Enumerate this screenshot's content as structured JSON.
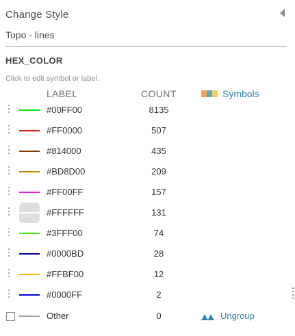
{
  "panel": {
    "title": "Change Style",
    "layer_name": "Topo - lines",
    "field_name": "HEX_COLOR",
    "hint": "Click to edit symbol or label."
  },
  "table": {
    "col_label": "LABEL",
    "col_count": "COUNT",
    "symbols_label": "Symbols",
    "symbols_swatch_colors": [
      "#f2a35c",
      "#58a8c6",
      "#f2d05c"
    ],
    "rows": [
      {
        "label": "#00FF00",
        "count": "8135",
        "color": "#00ee00"
      },
      {
        "label": "#FF0000",
        "count": "507",
        "color": "#cc1111"
      },
      {
        "label": "#814000",
        "count": "435",
        "color": "#814000"
      },
      {
        "label": "#BD8D00",
        "count": "209",
        "color": "#bd8d00"
      },
      {
        "label": "#FF00FF",
        "count": "157",
        "color": "#e020e0"
      },
      {
        "label": "#FFFFFF",
        "count": "131",
        "color": "#ffffff"
      },
      {
        "label": "#3FFF00",
        "count": "74",
        "color": "#3fee00"
      },
      {
        "label": "#0000BD",
        "count": "28",
        "color": "#00009d"
      },
      {
        "label": "#FFBF00",
        "count": "12",
        "color": "#f5bb00"
      },
      {
        "label": "#0000FF",
        "count": "2",
        "color": "#0000dd"
      }
    ],
    "other": {
      "label": "Other",
      "count": "0",
      "color": "#a6a6a6"
    },
    "ungroup_label": "Ungroup",
    "ungroup_icon": "ungroup-arrows-icon",
    "ungroup_icon_color": "#2a84b0"
  }
}
